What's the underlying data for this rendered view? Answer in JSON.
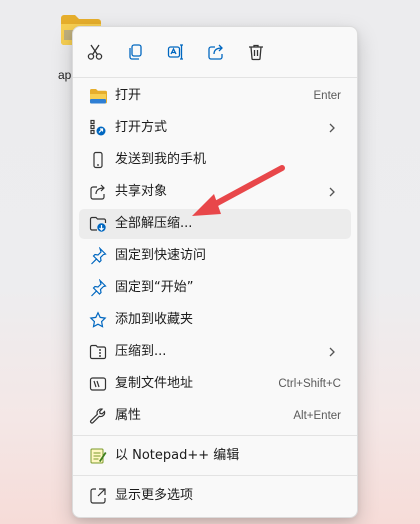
{
  "desktop": {
    "icon_label": "ap"
  },
  "toolbar": [
    "cut-icon",
    "copy-icon",
    "rename-icon",
    "share-icon",
    "delete-icon"
  ],
  "menu": {
    "open": {
      "label": "打开",
      "shortcut": "Enter"
    },
    "open_with": {
      "label": "打开方式"
    },
    "send_to_phone": {
      "label": "发送到我的手机"
    },
    "share": {
      "label": "共享对象"
    },
    "extract_all": {
      "label": "全部解压缩..."
    },
    "pin_quick_access": {
      "label": "固定到快速访问"
    },
    "pin_start": {
      "label": "固定到“开始”"
    },
    "add_favorites": {
      "label": "添加到收藏夹"
    },
    "compress_to": {
      "label": "压缩到..."
    },
    "copy_path": {
      "label": "复制文件地址",
      "shortcut": "Ctrl+Shift+C"
    },
    "properties": {
      "label": "属性",
      "shortcut": "Alt+Enter"
    },
    "notepad": {
      "label": "以 Notepad++ 编辑"
    },
    "more_options": {
      "label": "显示更多选项"
    }
  },
  "colors": {
    "accent": "#0067c0",
    "arrow": "#e8474a",
    "folder": "#f4c542"
  }
}
